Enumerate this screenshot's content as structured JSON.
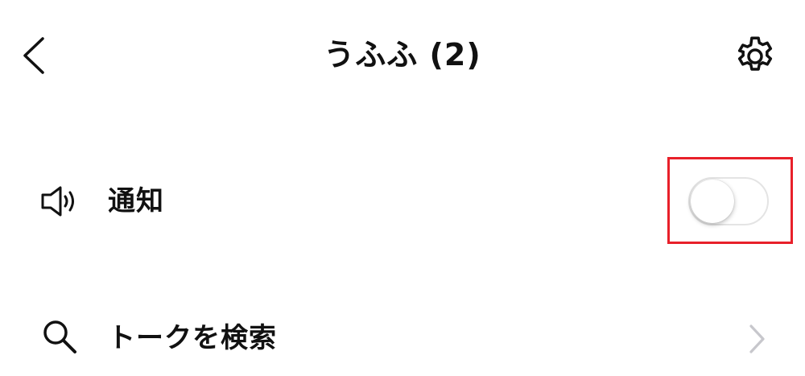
{
  "header": {
    "title": "うふふ (2)",
    "back_icon": "chevron-left-icon",
    "settings_icon": "gear-icon"
  },
  "rows": [
    {
      "label": "通知",
      "icon": "speaker-icon",
      "toggle": {
        "on": false
      }
    },
    {
      "label": "トークを検索",
      "icon": "search-icon",
      "accessory_icon": "chevron-right-icon"
    }
  ],
  "colors": {
    "highlight_border": "#e8202a",
    "toggle_track_off": "#ffffff",
    "toggle_border": "#e4e4e4",
    "chevron": "#c7c7cc"
  }
}
